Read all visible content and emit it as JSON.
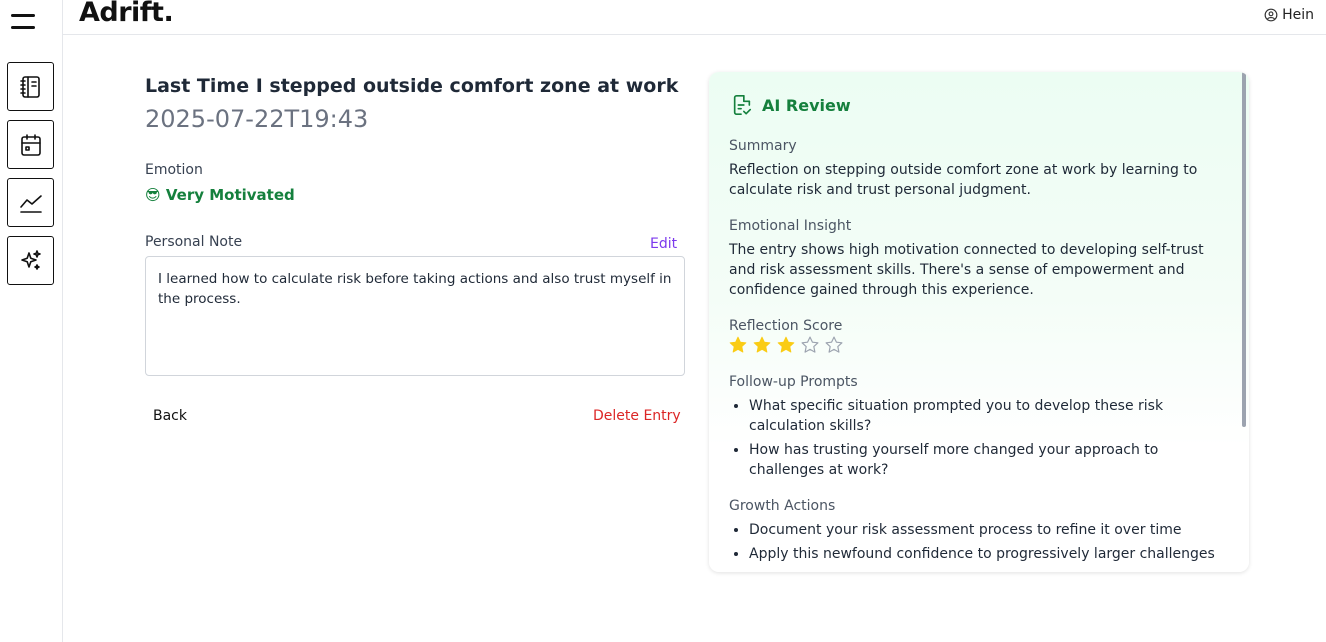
{
  "app": {
    "logo": "Adrift.",
    "user_name": "Hein"
  },
  "sidebar": {
    "items": [
      {
        "icon": "notebook-icon"
      },
      {
        "icon": "calendar-icon"
      },
      {
        "icon": "chart-line-icon"
      },
      {
        "icon": "sparkles-icon"
      }
    ]
  },
  "entry": {
    "title": "Last Time I stepped outside comfort zone at work",
    "date": "2025-07-22T19:43",
    "emotion_label": "Emotion",
    "emotion_emoji": "😎",
    "emotion_value": "Very Motivated",
    "note_label": "Personal Note",
    "edit_label": "Edit",
    "note_text": "I learned how to calculate risk before taking actions and also trust myself in the process.",
    "back_label": "Back",
    "delete_label": "Delete Entry"
  },
  "review": {
    "title": "AI Review",
    "summary_label": "Summary",
    "summary_text": "Reflection on stepping outside comfort zone at work by learning to calculate risk and trust personal judgment.",
    "insight_label": "Emotional Insight",
    "insight_text": "The entry shows high motivation connected to developing self-trust and risk assessment skills. There's a sense of empowerment and confidence gained through this experience.",
    "score_label": "Reflection Score",
    "score": 3,
    "score_max": 5,
    "prompts_label": "Follow-up Prompts",
    "prompts": [
      "What specific situation prompted you to develop these risk calculation skills?",
      "How has trusting yourself more changed your approach to challenges at work?"
    ],
    "actions_label": "Growth Actions",
    "actions": [
      "Document your risk assessment process to refine it over time",
      "Apply this newfound confidence to progressively larger challenges"
    ]
  },
  "colors": {
    "accent_green": "#15803d",
    "edit_purple": "#7c3aed",
    "delete_red": "#dc2626",
    "star_fill": "#facc15"
  }
}
